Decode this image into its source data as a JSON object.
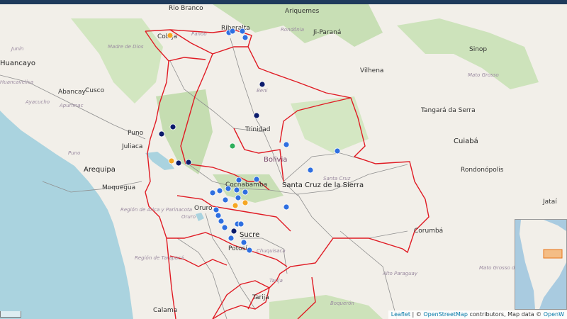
{
  "attribution": {
    "leaflet": "Leaflet",
    "sep1": " | © ",
    "osm": "OpenStreetMap",
    "mid": " contributors, Map data © ",
    "openw": "OpenW"
  },
  "labels": {
    "country": "Bolivia",
    "cities": [
      "Rio Branco",
      "Ariquemes",
      "Ji-Paraná",
      "Vilhena",
      "Sinop",
      "Huancayo",
      "Abancay",
      "Cusco",
      "Juliaca",
      "Arequipa",
      "Moquegua",
      "Riberalta",
      "Trinidad",
      "Santa Cruz de la Sierra",
      "Sucre",
      "Tarija",
      "Calama",
      "Cuiabá",
      "Tangará da Serra",
      "Rondonópolis",
      "Corumbá",
      "Jataí",
      "Oruro",
      "Potosí",
      "Cochabamba",
      "Puno",
      "Cobija"
    ],
    "regions": [
      "Rondônia",
      "Junín",
      "Madre de Dios",
      "Pando",
      "Beni",
      "Huancavelica",
      "Apurímac",
      "Ayacucho",
      "Puno",
      "Región de Arica y Parinacota",
      "Región de Tarapacá",
      "Chuquisaca",
      "Mato Grosso",
      "Mato Grosso do Sul",
      "Alto Paraguay",
      "Boquerón",
      "Santa Cruz",
      "Oruro",
      "Tarija"
    ]
  },
  "markers": [
    {
      "color": "#f5a623"
    },
    {
      "color": "#2f6fe0"
    },
    {
      "color": "#2f6fe0"
    },
    {
      "color": "#2f6fe0"
    },
    {
      "color": "#2f6fe0"
    },
    {
      "color": "#0b1b6b"
    },
    {
      "color": "#0b1b6b"
    },
    {
      "color": "#0b1b6b"
    },
    {
      "color": "#0b1b6b"
    },
    {
      "color": "#0b1b6b"
    },
    {
      "color": "#f5a623"
    },
    {
      "color": "#0b1b6b"
    },
    {
      "color": "#2fae5b"
    },
    {
      "color": "#2f6fe0"
    },
    {
      "color": "#2f6fe0"
    },
    {
      "color": "#2f6fe0"
    },
    {
      "color": "#2f6fe0"
    },
    {
      "color": "#2f6fe0"
    },
    {
      "color": "#2f6fe0"
    },
    {
      "color": "#2f6fe0"
    },
    {
      "color": "#2f6fe0"
    },
    {
      "color": "#2f6fe0"
    },
    {
      "color": "#2f6fe0"
    },
    {
      "color": "#2f6fe0"
    },
    {
      "color": "#f5a623"
    },
    {
      "color": "#f5a623"
    },
    {
      "color": "#2f6fe0"
    },
    {
      "color": "#2f6fe0"
    },
    {
      "color": "#2f6fe0"
    },
    {
      "color": "#2f6fe0"
    },
    {
      "color": "#2f6fe0"
    },
    {
      "color": "#2f6fe0"
    },
    {
      "color": "#2f6fe0"
    },
    {
      "color": "#2f6fe0"
    },
    {
      "color": "#0b1b6b"
    },
    {
      "color": "#2f6fe0"
    },
    {
      "color": "#2f6fe0"
    },
    {
      "color": "#2f6fe0"
    }
  ]
}
